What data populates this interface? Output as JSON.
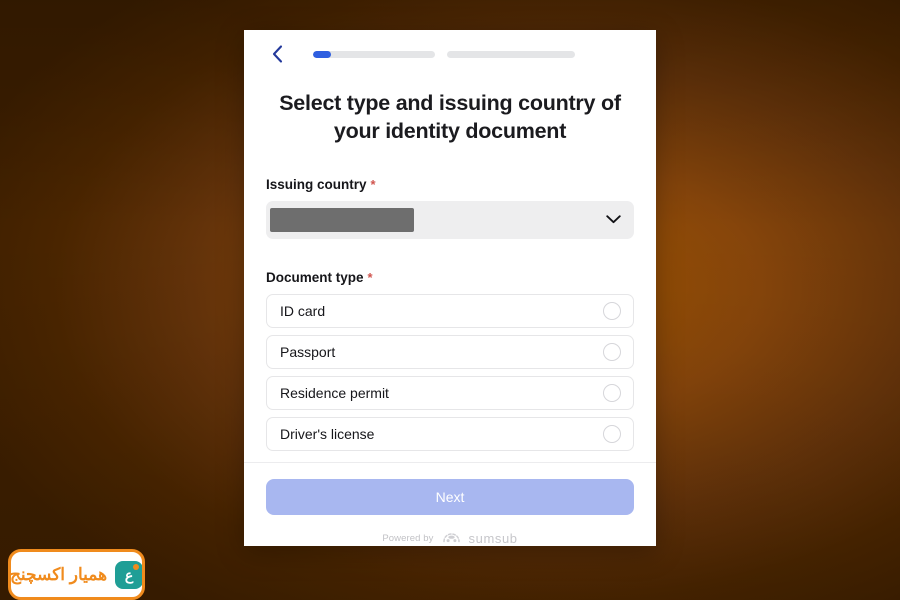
{
  "background": {
    "color_dark": "#4a2600",
    "color_mid": "#8a4a00",
    "color_edge": "#3c1e00"
  },
  "card": {
    "background": "#ffffff"
  },
  "topbar": {
    "back_icon": "chevron-left-icon",
    "back_color": "#23399b",
    "progress": {
      "accent": "#2f5fe0",
      "track": "#e4e5e7",
      "segments": [
        {
          "name": "step-1",
          "fill_percent": 15
        },
        {
          "name": "step-2",
          "fill_percent": 0
        }
      ]
    }
  },
  "title": "Select type and issuing country of your identity document",
  "issuing_country": {
    "label": "Issuing country",
    "required_marker": "*",
    "required_color": "#d0544e",
    "value": "",
    "value_masked": true,
    "chevron_icon": "chevron-down-icon"
  },
  "document_type": {
    "label": "Document type",
    "required_marker": "*",
    "required_color": "#d0544e",
    "selected": null,
    "options": [
      {
        "label": "ID card",
        "selected": false
      },
      {
        "label": "Passport",
        "selected": false
      },
      {
        "label": "Residence permit",
        "selected": false
      },
      {
        "label": "Driver's license",
        "selected": false
      }
    ]
  },
  "footer": {
    "next_label": "Next",
    "next_disabled": true,
    "next_color": "#a8b7f0",
    "powered_by_text": "Powered by",
    "brand_name": "sumsub",
    "brand_logo_icon": "sumsub-logo-icon"
  },
  "watermark": {
    "text": "همیار اکسچنج",
    "logo_glyph": "ع",
    "border_color": "#f08b1d",
    "text_color": "#f08b1d",
    "logo_color": "#1f9e96"
  }
}
